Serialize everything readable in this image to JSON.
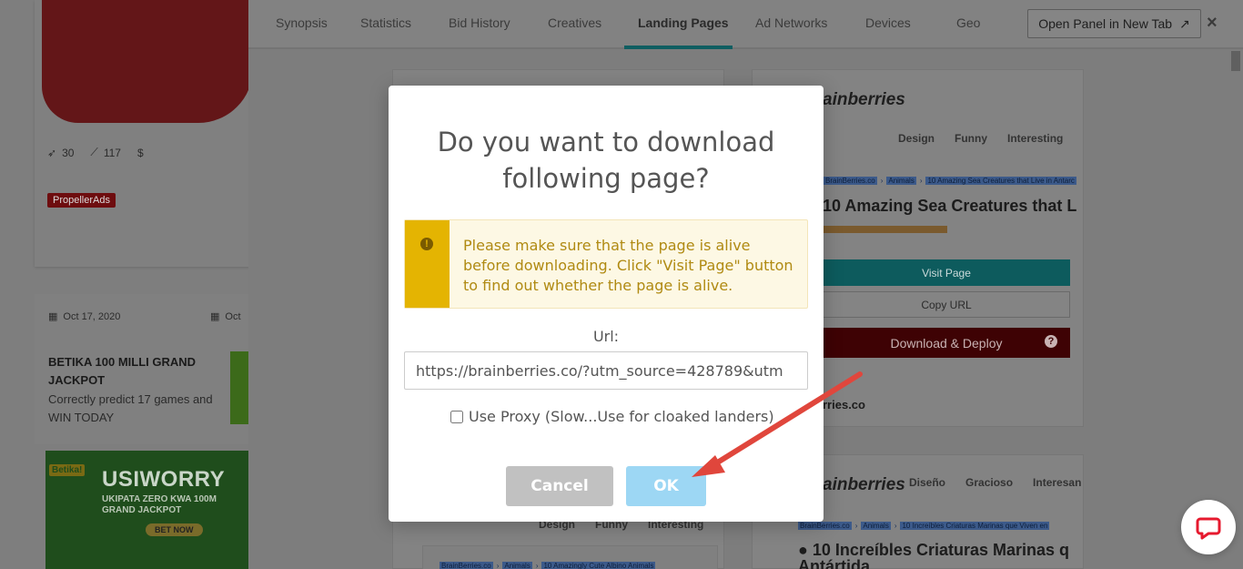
{
  "background": {
    "card1": {
      "launches": "30",
      "trend": "117",
      "currency": "$",
      "badge": "PropellerAds"
    },
    "card2": {
      "date1": "Oct 17, 2020",
      "date2": "Oct",
      "title": "BETIKA 100 MILLI GRAND JACKPOT",
      "desc": "Correctly predict 17 games and WIN TODAY"
    },
    "card3": {
      "logo": "Betika!",
      "head": "USIWORRY",
      "sub": "UKIPATA ZERO KWA 100M GRAND JACKPOT",
      "button": "BET NOW"
    }
  },
  "panel": {
    "tabs": [
      "Synopsis",
      "Statistics",
      "Bid History",
      "Creatives",
      "Landing Pages",
      "Ad Networks",
      "Devices",
      "Geo"
    ],
    "active_tab": "Landing Pages",
    "open_panel_label": "Open Panel in New Tab",
    "close_label": "×",
    "lp_right": {
      "brand": "ainberries",
      "nav": [
        "Design",
        "Funny",
        "Interesting"
      ],
      "crumbs": [
        "BrainBerries.co",
        "Animals",
        "10 Amazing Sea Creatures that Live in Antarc"
      ],
      "headline": "10 Amazing Sea Creatures that Li",
      "visit_label": "Visit Page",
      "copy_label": "Copy URL",
      "deploy_label": "Download & Deploy",
      "domain": "rries.co"
    },
    "lp_right2": {
      "brand": "ainberries",
      "nav": [
        "Diseño",
        "Gracioso",
        "Interesan"
      ],
      "crumbs": [
        "BrainBerries.co",
        "Animals",
        "10 Increíbles Criaturas Marinas que Viven en"
      ],
      "headline": "10 Increíbles Criaturas Marinas q",
      "headline2": "Antártida"
    },
    "lp_left": {
      "nav": [
        "Design",
        "Funny",
        "Interesting"
      ],
      "crumbs": [
        "BrainBerries.co",
        "Animals",
        "10 Amazingly Cute Albino Animals"
      ]
    }
  },
  "modal": {
    "title": "Do you want to download following page?",
    "warning": "Please make sure that the page is alive before downloading. Click \"Visit Page\" button to find out whether the page is alive.",
    "url_label": "Url:",
    "url_value": "https://brainberries.co/?utm_source=428789&utm",
    "proxy_label": "Use Proxy (Slow...Use for cloaked landers)",
    "cancel_label": "Cancel",
    "ok_label": "OK"
  },
  "colors": {
    "warning_strip": "#e4b402",
    "ok_button": "#9dd7f4",
    "cancel_button": "#c1c1c1",
    "arrow": "#e0463c"
  }
}
